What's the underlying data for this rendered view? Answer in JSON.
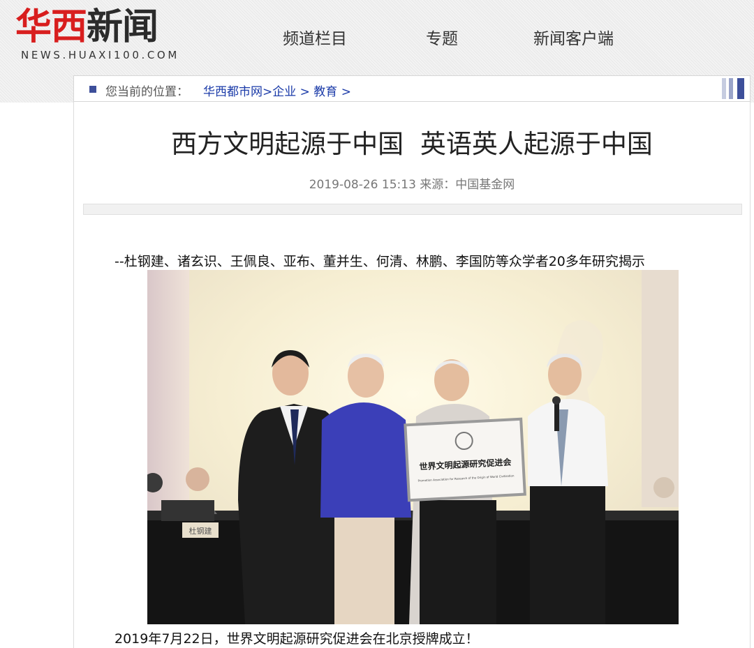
{
  "header": {
    "logo_red": "华西",
    "logo_dark": "新闻",
    "logo_en": "NEWS.HUAXI100.COM",
    "nav": [
      "频道栏目",
      "专题",
      "新闻客户端"
    ]
  },
  "breadcrumb": {
    "label": "您当前的位置：",
    "items": [
      "华西都市网",
      ">企业",
      " > 教育",
      " >"
    ]
  },
  "article": {
    "title": "西方文明起源于中国 英语英人起源于中国",
    "meta": "2019-08-26 15:13 来源：中国基金网",
    "subtitle": "--杜钢建、诸玄识、王佩良、亚布、董并生、何清、林鹏、李国防等众学者20多年研究揭示",
    "photo": {
      "plaque_cn": "世界文明起源研究促进会",
      "plaque_en": "Promotion Association for Research of the Origin of World Civilization",
      "nameplate": "杜钢建"
    },
    "caption": "2019年7月22日，世界文明起源研究促进会在北京授牌成立！"
  },
  "colors": {
    "logo_red": "#d81e1e",
    "link_blue": "#1a3aa8",
    "breadcrumb_square": "#3d4f9a"
  }
}
